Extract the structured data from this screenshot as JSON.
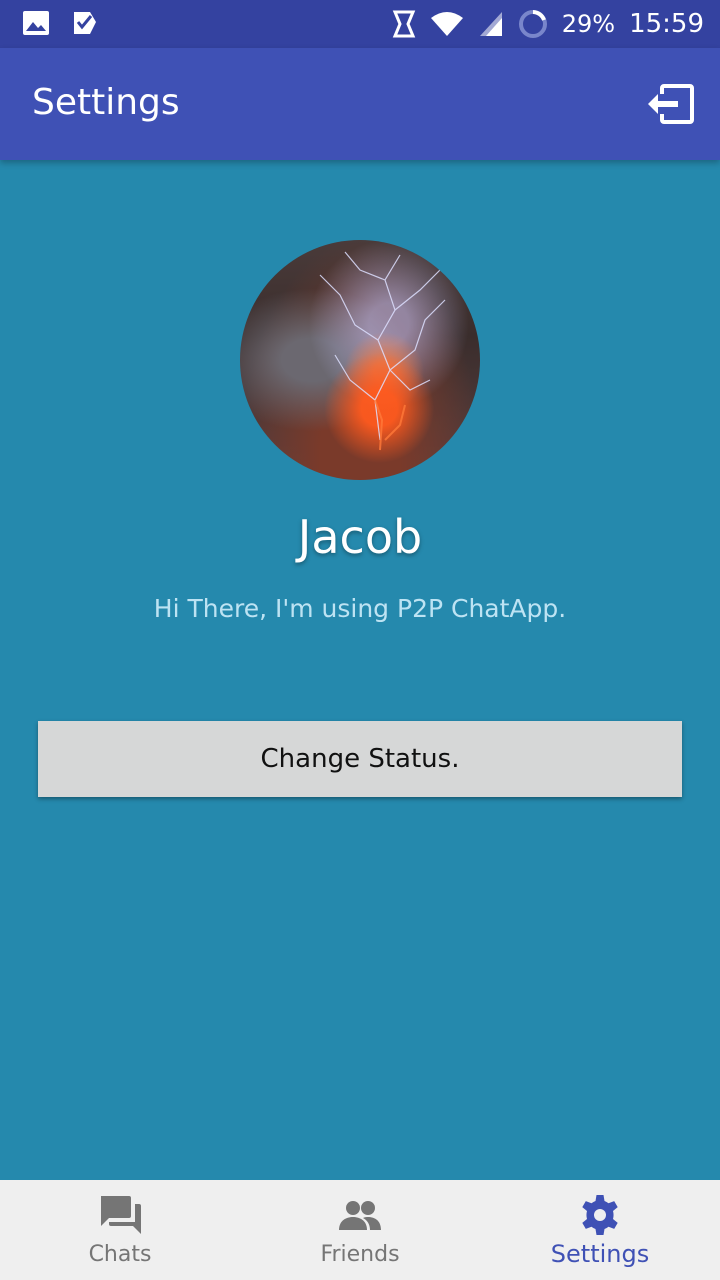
{
  "status_bar": {
    "battery": "29%",
    "time": "15:59"
  },
  "app_bar": {
    "title": "Settings"
  },
  "profile": {
    "name": "Jacob",
    "status": "Hi There, I'm using P2P ChatApp.",
    "change_status_label": "Change Status."
  },
  "bottom_nav": {
    "items": [
      {
        "label": "Chats",
        "icon": "chat-icon"
      },
      {
        "label": "Friends",
        "icon": "people-icon"
      },
      {
        "label": "Settings",
        "icon": "gear-icon"
      }
    ],
    "active": "Settings"
  },
  "colors": {
    "status_bar": "#3442A0",
    "app_bar": "#3F51B5",
    "background": "#2589AD",
    "accent": "#3F51B5"
  }
}
